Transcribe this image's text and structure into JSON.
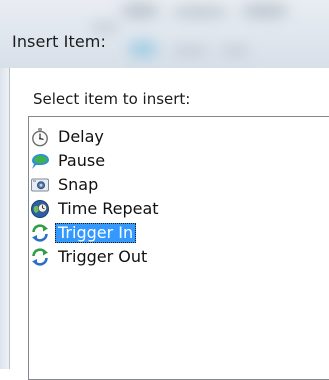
{
  "window": {
    "title": "Insert Item:"
  },
  "dialog": {
    "prompt": "Select item to insert:"
  },
  "items": [
    {
      "label": "Delay",
      "icon": "stopwatch-icon",
      "selected": false
    },
    {
      "label": "Pause",
      "icon": "speech-bubble-icon",
      "selected": false
    },
    {
      "label": "Snap",
      "icon": "camera-icon",
      "selected": false
    },
    {
      "label": "Time Repeat",
      "icon": "clock-globe-icon",
      "selected": false
    },
    {
      "label": "Trigger In",
      "icon": "refresh-arrows-icon",
      "selected": true
    },
    {
      "label": "Trigger Out",
      "icon": "refresh-arrows-icon",
      "selected": false
    }
  ],
  "colors": {
    "selection": "#3399ff",
    "accent_green": "#34a84a",
    "accent_blue": "#2b6fc5"
  }
}
